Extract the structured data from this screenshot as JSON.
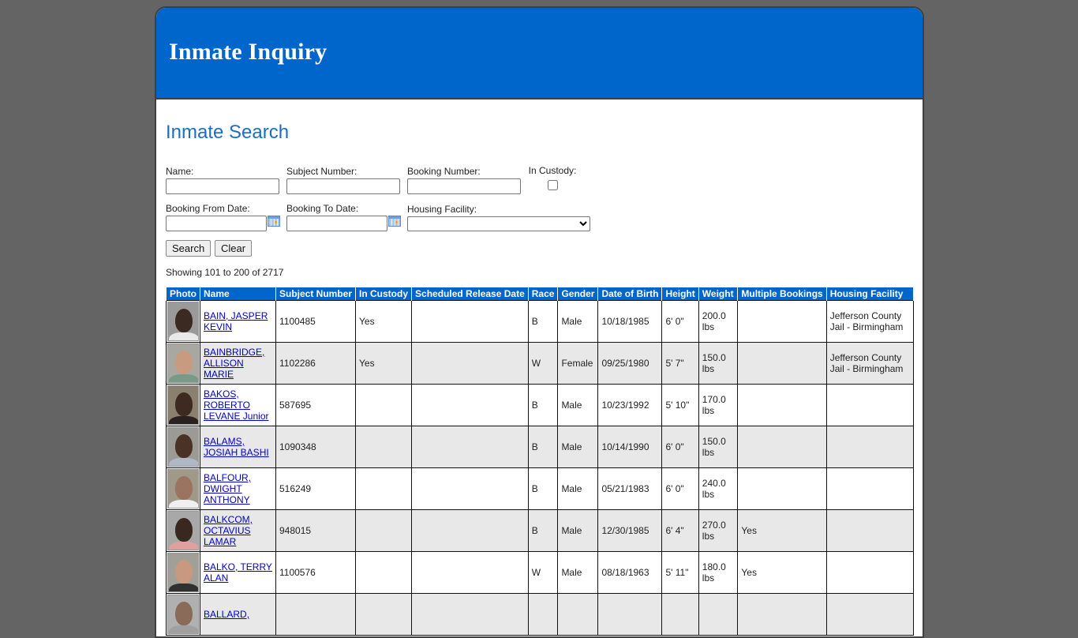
{
  "header": {
    "title": "Inmate Inquiry"
  },
  "page_title": "Inmate Search",
  "form": {
    "name": {
      "label": "Name:",
      "value": ""
    },
    "subject_number": {
      "label": "Subject Number:",
      "value": ""
    },
    "booking_number": {
      "label": "Booking Number:",
      "value": ""
    },
    "in_custody": {
      "label": "In Custody:",
      "checked": false
    },
    "booking_from_date": {
      "label": "Booking From Date:",
      "value": ""
    },
    "booking_to_date": {
      "label": "Booking To Date:",
      "value": ""
    },
    "housing_facility": {
      "label": "Housing Facility:",
      "selected": ""
    },
    "search_label": "Search",
    "clear_label": "Clear",
    "calendar_icon": "calendar-icon"
  },
  "results": {
    "summary": "Showing 101 to 200 of 2717",
    "columns": [
      "Photo",
      "Name",
      "Subject Number",
      "In Custody",
      "Scheduled Release Date",
      "Race",
      "Gender",
      "Date of Birth",
      "Height",
      "Weight",
      "Multiple Bookings",
      "Housing Facility"
    ],
    "rows": [
      {
        "name": "BAIN, JASPER KEVIN",
        "subject_number": "1100485",
        "in_custody": "Yes",
        "release_date": "",
        "race": "B",
        "gender": "Male",
        "dob": "10/18/1985",
        "height": "6' 0\"",
        "weight": "200.0 lbs",
        "multiple_bookings": "",
        "housing_facility": "Jefferson County Jail - Birmingham"
      },
      {
        "name": "BAINBRIDGE, ALLISON MARIE",
        "subject_number": "1102286",
        "in_custody": "Yes",
        "release_date": "",
        "race": "W",
        "gender": "Female",
        "dob": "09/25/1980",
        "height": "5' 7\"",
        "weight": "150.0 lbs",
        "multiple_bookings": "",
        "housing_facility": "Jefferson County Jail - Birmingham"
      },
      {
        "name": "BAKOS, ROBERTO LEVANE Junior",
        "subject_number": "587695",
        "in_custody": "",
        "release_date": "",
        "race": "B",
        "gender": "Male",
        "dob": "10/23/1992",
        "height": "5' 10\"",
        "weight": "170.0 lbs",
        "multiple_bookings": "",
        "housing_facility": ""
      },
      {
        "name": "BALAMS, JOSIAH BASHI",
        "subject_number": "1090348",
        "in_custody": "",
        "release_date": "",
        "race": "B",
        "gender": "Male",
        "dob": "10/14/1990",
        "height": "6' 0\"",
        "weight": "150.0 lbs",
        "multiple_bookings": "",
        "housing_facility": ""
      },
      {
        "name": "BALFOUR, DWIGHT ANTHONY",
        "subject_number": "516249",
        "in_custody": "",
        "release_date": "",
        "race": "B",
        "gender": "Male",
        "dob": "05/21/1983",
        "height": "6' 0\"",
        "weight": "240.0 lbs",
        "multiple_bookings": "",
        "housing_facility": ""
      },
      {
        "name": "BALKCOM, OCTAVIUS LAMAR",
        "subject_number": "948015",
        "in_custody": "",
        "release_date": "",
        "race": "B",
        "gender": "Male",
        "dob": "12/30/1985",
        "height": "6' 4\"",
        "weight": "270.0 lbs",
        "multiple_bookings": "Yes",
        "housing_facility": ""
      },
      {
        "name": "BALKO, TERRY ALAN",
        "subject_number": "1100576",
        "in_custody": "",
        "release_date": "",
        "race": "W",
        "gender": "Male",
        "dob": "08/18/1963",
        "height": "5' 11\"",
        "weight": "180.0 lbs",
        "multiple_bookings": "Yes",
        "housing_facility": ""
      },
      {
        "name": "BALLARD,",
        "subject_number": "",
        "in_custody": "",
        "release_date": "",
        "race": "",
        "gender": "",
        "dob": "",
        "height": "",
        "weight": "",
        "multiple_bookings": "",
        "housing_facility": ""
      }
    ]
  },
  "colors": {
    "banner": "#0066cc",
    "page_title": "#1c6dc4",
    "table_header": "#0066cc",
    "alt_row": "#e8e8e8",
    "link": "#0000cc",
    "page_background": "#646464"
  }
}
